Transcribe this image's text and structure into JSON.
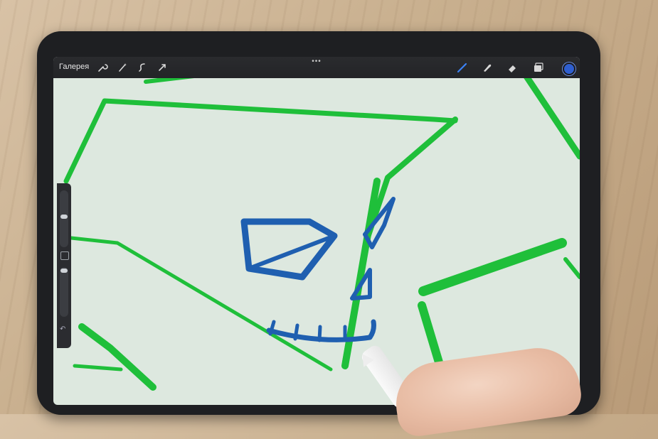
{
  "toolbar": {
    "gallery_label": "Галерея",
    "left_tools": [
      "wrench-icon",
      "magic-wand-icon",
      "selection-icon",
      "transform-arrow-icon"
    ],
    "more_label": "•••",
    "right_tools": [
      "brush-icon",
      "smudge-icon",
      "eraser-icon",
      "layers-icon"
    ],
    "active_color": "#2f5fd0"
  },
  "sidebar": {
    "controls": [
      "brush-size-slider",
      "modify-button",
      "brush-opacity-slider",
      "undo-button"
    ],
    "undo_glyph": "↶"
  },
  "drawing": {
    "stroke_colors": {
      "green": "#1fbf3a",
      "blue": "#1f5fb0"
    },
    "canvas_background": "#dde8df"
  },
  "scene": {
    "background": "wooden-table",
    "device": "ipad-with-apple-pencil"
  }
}
